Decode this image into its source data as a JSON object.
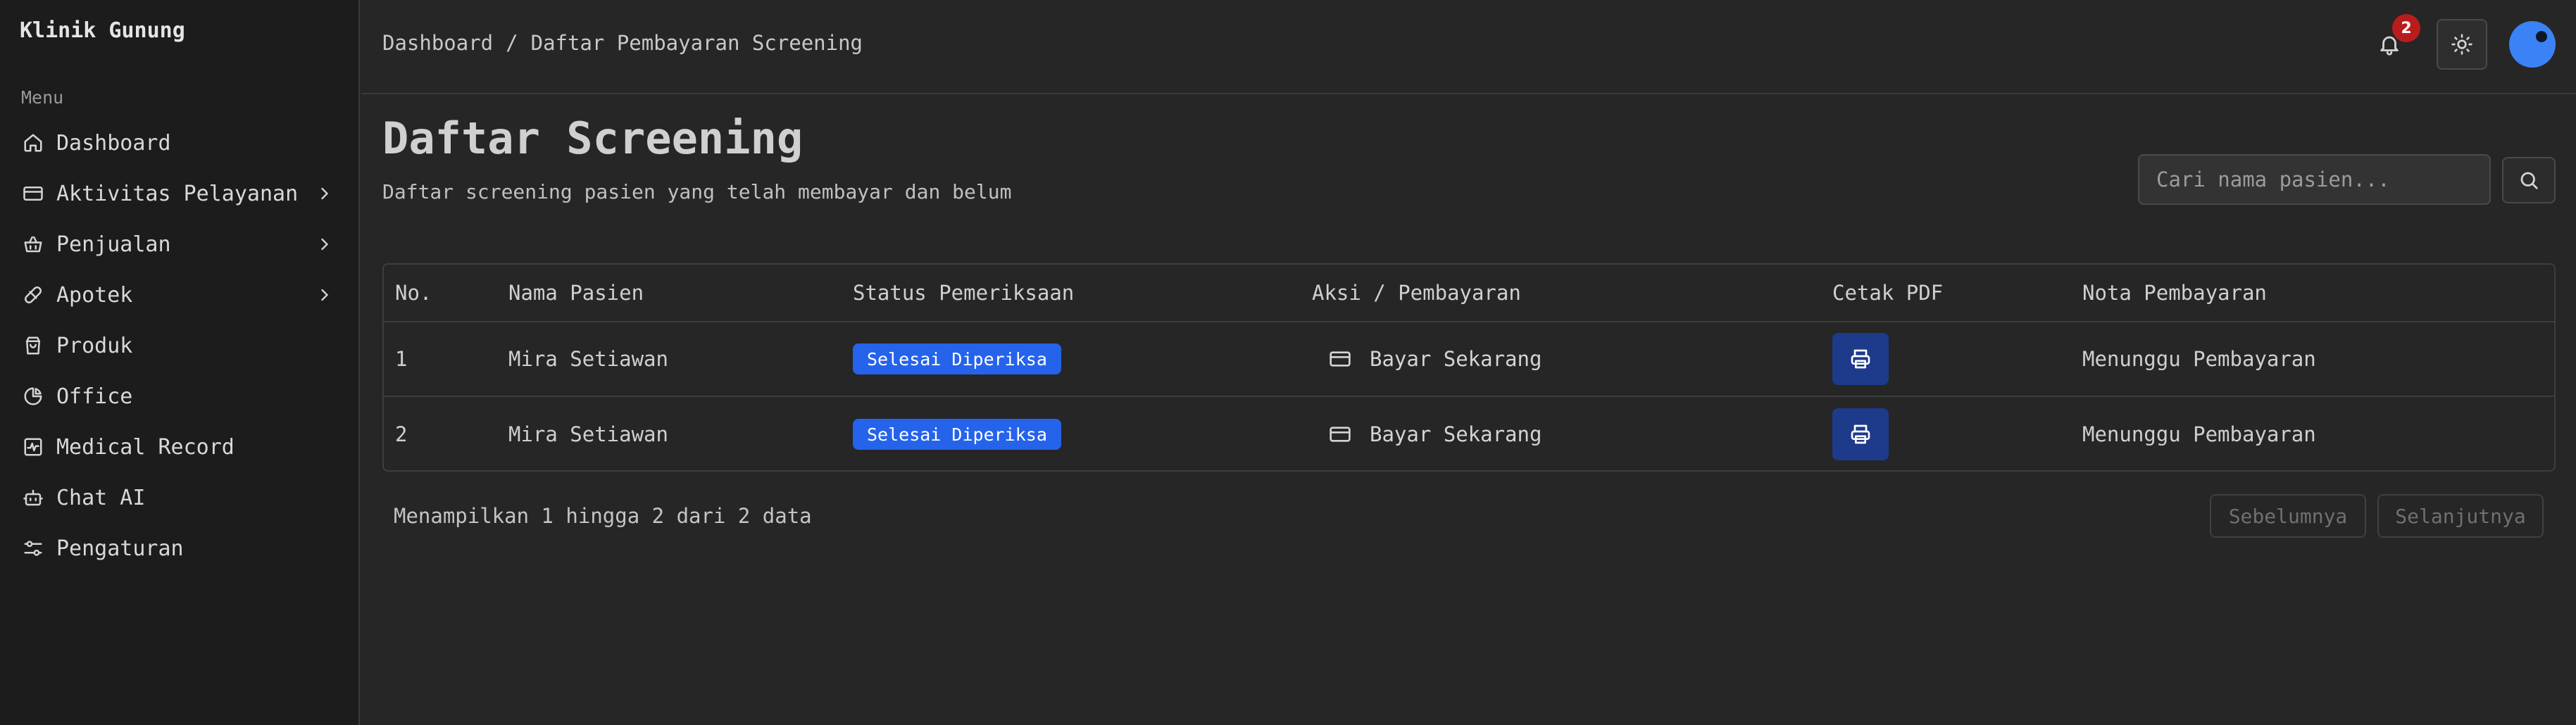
{
  "sidebar": {
    "brand": "Klinik Gunung",
    "menu_caption": "Menu",
    "items": [
      {
        "label": "Dashboard",
        "icon": "home-icon",
        "has_submenu": false
      },
      {
        "label": "Aktivitas Pelayanan",
        "icon": "credit-card-icon",
        "has_submenu": true
      },
      {
        "label": "Penjualan",
        "icon": "basket-icon",
        "has_submenu": true
      },
      {
        "label": "Apotek",
        "icon": "pill-icon",
        "has_submenu": true
      },
      {
        "label": "Produk",
        "icon": "shopping-bag-icon",
        "has_submenu": false
      },
      {
        "label": "Office",
        "icon": "pie-chart-icon",
        "has_submenu": false
      },
      {
        "label": "Medical Record",
        "icon": "activity-square-icon",
        "has_submenu": false
      },
      {
        "label": "Chat AI",
        "icon": "bot-icon",
        "has_submenu": false
      },
      {
        "label": "Pengaturan",
        "icon": "settings-sliders-icon",
        "has_submenu": false
      }
    ]
  },
  "header": {
    "breadcrumb": {
      "home": "Dashboard",
      "separator": "/",
      "current": "Daftar Pembayaran Screening"
    },
    "notifications_count": "2",
    "accent_color": "#3b82f6"
  },
  "main": {
    "title": "Daftar Screening",
    "subtitle": "Daftar screening pasien yang telah membayar dan belum",
    "search": {
      "placeholder": "Cari nama pasien...",
      "value": ""
    },
    "table": {
      "columns": [
        "No.",
        "Nama Pasien",
        "Status Pemeriksaan",
        "Aksi / Pembayaran",
        "Cetak PDF",
        "Nota Pembayaran"
      ],
      "rows": [
        {
          "no": "1",
          "name": "Mira Setiawan",
          "status": "Selesai Diperiksa",
          "action": "Bayar Sekarang",
          "nota": "Menunggu Pembayaran"
        },
        {
          "no": "2",
          "name": "Mira Setiawan",
          "status": "Selesai Diperiksa",
          "action": "Bayar Sekarang",
          "nota": "Menunggu Pembayaran"
        }
      ]
    },
    "pagination": {
      "info": "Menampilkan 1 hingga 2 dari 2 data",
      "prev_label": "Sebelumnya",
      "next_label": "Selanjutnya"
    }
  }
}
